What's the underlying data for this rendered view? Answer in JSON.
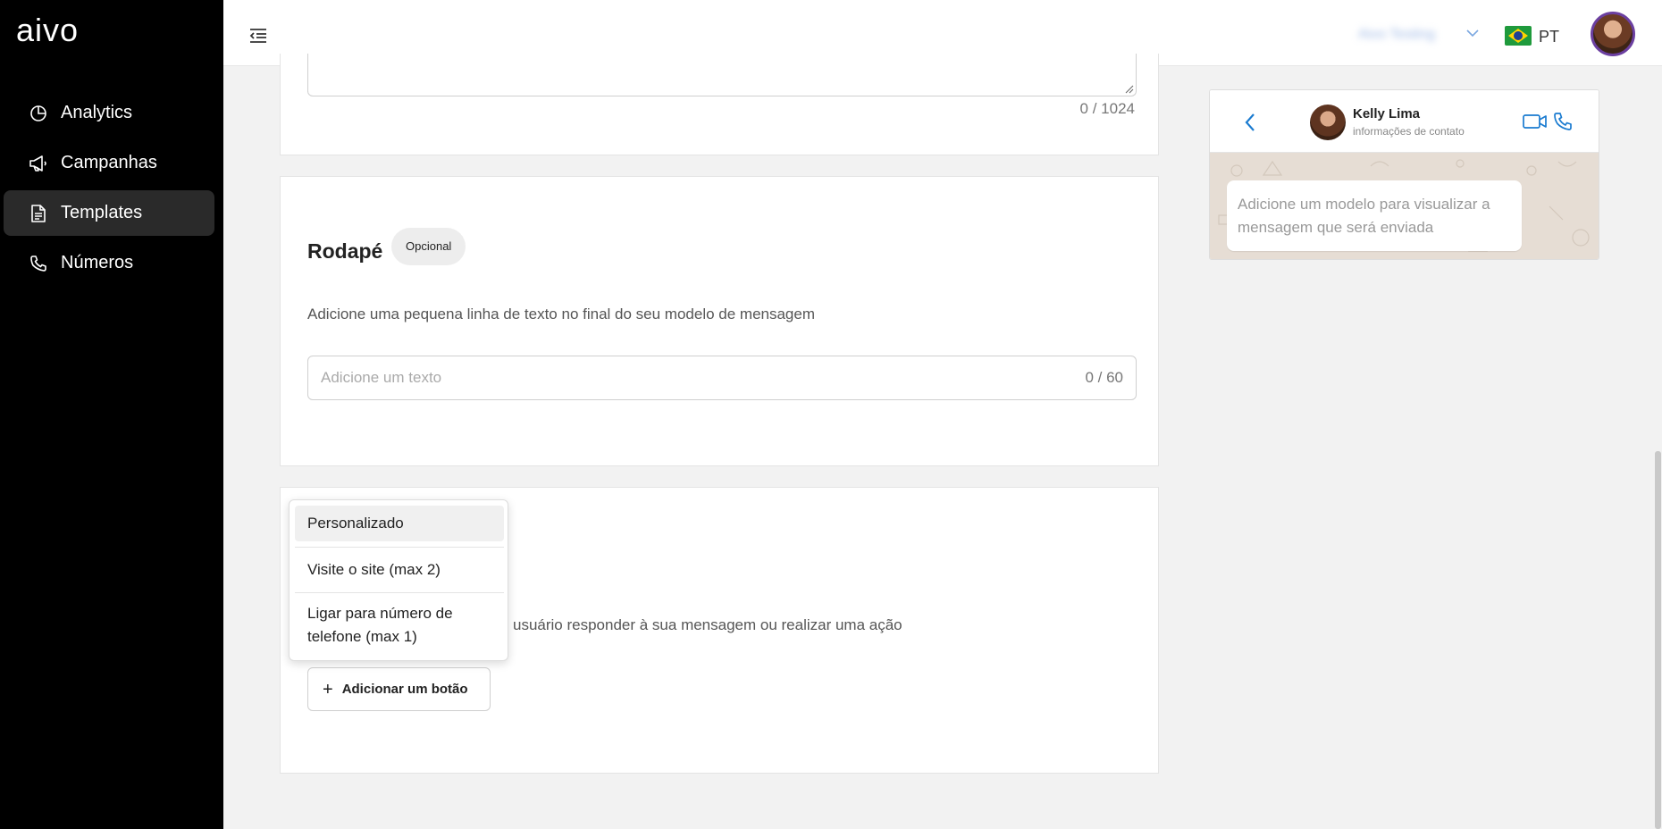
{
  "brand": {
    "logo_text": "aivo"
  },
  "sidebar": {
    "items": [
      {
        "label": "Analytics",
        "icon": "pie-chart-icon"
      },
      {
        "label": "Campanhas",
        "icon": "megaphone-icon"
      },
      {
        "label": "Templates",
        "icon": "document-icon",
        "active": true
      },
      {
        "label": "Números",
        "icon": "phone-icon"
      }
    ]
  },
  "topbar": {
    "account_name": "Aivo Testing",
    "language": "PT",
    "flag": "brazil-flag-icon"
  },
  "body_section": {
    "counter": "0 / 1024"
  },
  "footer_section": {
    "title": "Rodapé",
    "badge": "Opcional",
    "description": "Adicione uma pequena linha de texto no final do seu modelo de mensagem",
    "placeholder": "Adicione um texto",
    "counter": "0 / 60"
  },
  "buttons_section": {
    "description": "usuário responder à sua mensagem ou realizar uma ação",
    "add_button_label": "Adicionar um botão",
    "dropdown": [
      "Personalizado",
      "Visite o site (max 2)",
      "Ligar para número de telefone (max 1)"
    ]
  },
  "preview": {
    "contact_name": "Kelly Lima",
    "contact_subtitle": "informações de contato",
    "placeholder_message": "Adicione um modelo para visualizar a mensagem que será enviada"
  },
  "colors": {
    "sidebar_bg": "#000000",
    "accent_blue": "#1a7bd0",
    "avatar_ring": "#6b3fa0"
  }
}
